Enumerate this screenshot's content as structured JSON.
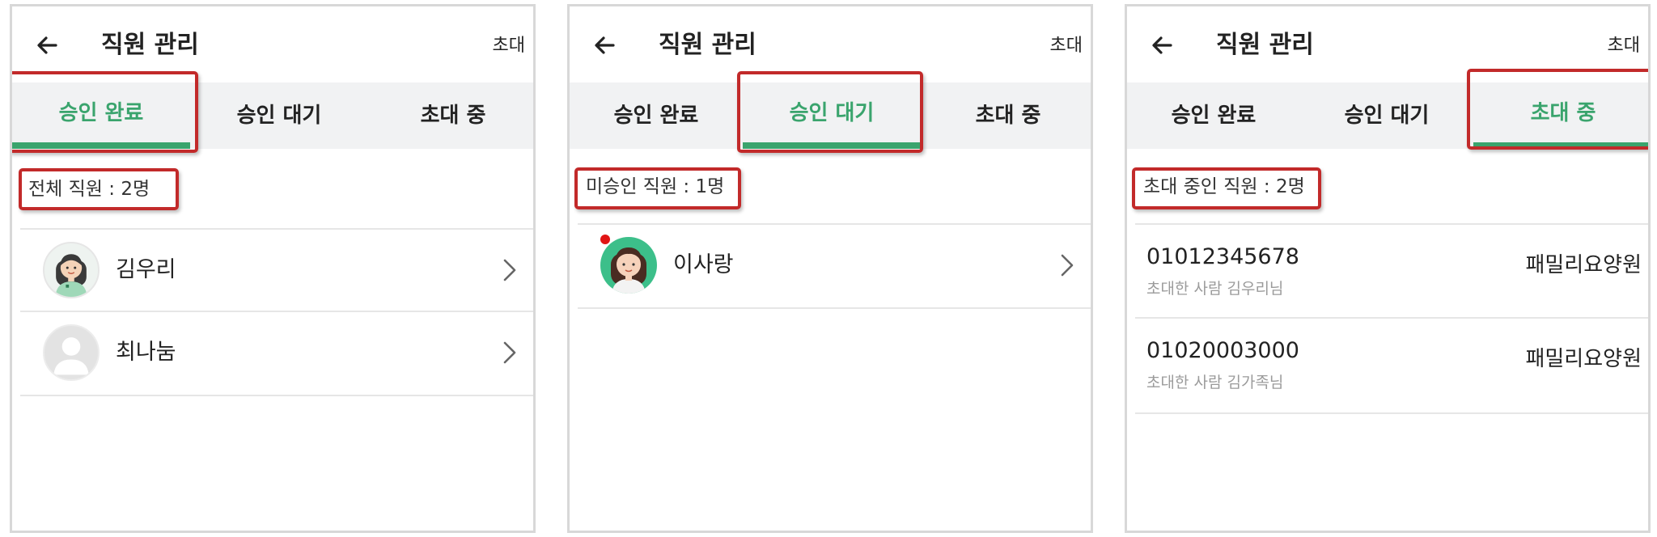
{
  "panels": [
    {
      "header": {
        "title": "직원 관리",
        "invite_label": "초대"
      },
      "tabs": [
        {
          "label": "승인 완료",
          "active": true
        },
        {
          "label": "승인 대기",
          "active": false
        },
        {
          "label": "초대 중",
          "active": false
        }
      ],
      "count_label": "전체 직원 : 2명",
      "staff": [
        {
          "name": "김우리",
          "avatar": "female-staff-avatar"
        },
        {
          "name": "최나눔",
          "avatar": "default-user-avatar"
        }
      ]
    },
    {
      "header": {
        "title": "직원 관리",
        "invite_label": "초대"
      },
      "tabs": [
        {
          "label": "승인 완료",
          "active": false
        },
        {
          "label": "승인 대기",
          "active": true
        },
        {
          "label": "초대 중",
          "active": false
        }
      ],
      "count_label": "미승인 직원 : 1명",
      "staff": [
        {
          "name": "이사랑",
          "avatar": "female-staff-avatar",
          "unread": true
        }
      ]
    },
    {
      "header": {
        "title": "직원 관리",
        "invite_label": "초대"
      },
      "tabs": [
        {
          "label": "승인 완료",
          "active": false
        },
        {
          "label": "승인 대기",
          "active": false
        },
        {
          "label": "초대 중",
          "active": true
        }
      ],
      "count_label": "초대 중인 직원 : 2명",
      "invites": [
        {
          "phone": "01012345678",
          "inviter": "초대한 사람 김우리님",
          "facility": "패밀리요양원"
        },
        {
          "phone": "01020003000",
          "inviter": "초대한 사람 김가족님",
          "facility": "패밀리요양원"
        }
      ]
    }
  ],
  "colors": {
    "accent": "#3aa46d",
    "highlight": "#c22a2a",
    "tab_bg": "#f1f2f3",
    "unread_dot": "#e11515"
  }
}
